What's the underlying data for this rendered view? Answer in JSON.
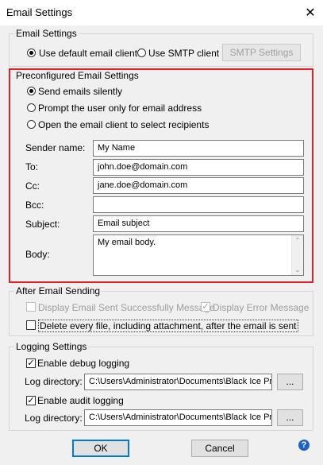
{
  "window": {
    "title": "Email Settings",
    "close_glyph": "✕"
  },
  "email_settings": {
    "legend": "Email Settings",
    "use_default_label": "Use default email client",
    "use_smtp_label": "Use SMTP client",
    "smtp_button": "SMTP Settings",
    "selected": "default"
  },
  "preconfigured": {
    "legend": "Preconfigured Email Settings",
    "options": [
      {
        "label": "Send emails silently",
        "selected": true
      },
      {
        "label": "Prompt the user only for email address",
        "selected": false
      },
      {
        "label": "Open the email client to select recipients",
        "selected": false
      }
    ],
    "sender_label": "Sender name:",
    "sender_value": "My Name",
    "to_label": "To:",
    "to_value": "john.doe@domain.com",
    "cc_label": "Cc:",
    "cc_value": "jane.doe@domain.com",
    "bcc_label": "Bcc:",
    "bcc_value": "",
    "subject_label": "Subject:",
    "subject_value": "Email subject",
    "body_label": "Body:",
    "body_value": "My email body."
  },
  "after_sending": {
    "legend": "After Email Sending",
    "display_sent_label": "Display Email Sent Successfully Message",
    "display_sent_checked": false,
    "display_error_label": "Display Error Message",
    "display_error_checked": true,
    "delete_label": "Delete every file, including attachment, after the email is sent",
    "delete_checked": false
  },
  "logging": {
    "legend": "Logging Settings",
    "debug_label": "Enable debug logging",
    "debug_checked": true,
    "debug_dir_label": "Log directory:",
    "debug_dir_value": "C:\\Users\\Administrator\\Documents\\Black Ice Pri",
    "audit_label": "Enable audit logging",
    "audit_checked": true,
    "audit_dir_label": "Log directory:",
    "audit_dir_value": "C:\\Users\\Administrator\\Documents\\Black Ice Pri",
    "browse_label": "..."
  },
  "footer": {
    "ok": "OK",
    "cancel": "Cancel",
    "help": "?"
  },
  "colors": {
    "highlight_border": "#e0202a",
    "help_icon": "#1e62c8"
  }
}
